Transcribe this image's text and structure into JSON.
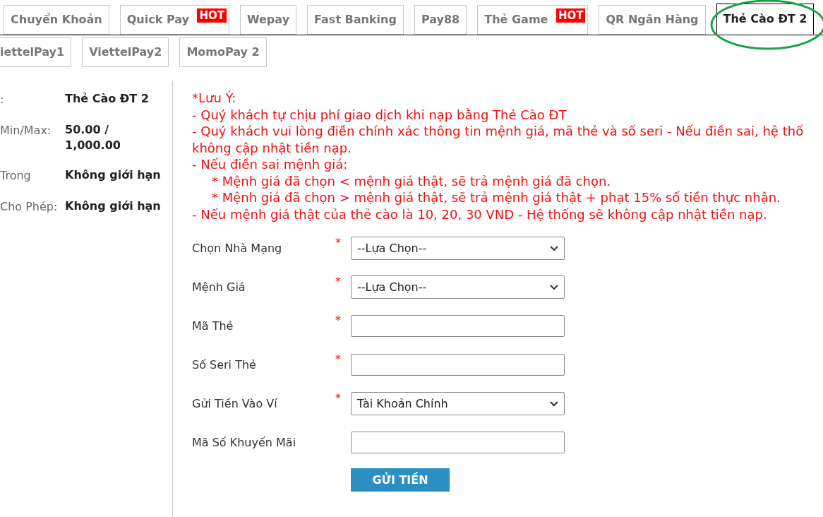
{
  "tabs_row_1": [
    {
      "label": "Chuyển Khoản",
      "selected": false,
      "hot": false
    },
    {
      "label": "Quick Pay",
      "selected": false,
      "hot": true,
      "badge": "HOT"
    },
    {
      "label": "Wepay",
      "selected": false,
      "hot": false
    },
    {
      "label": "Fast Banking",
      "selected": false,
      "hot": false
    },
    {
      "label": "Pay88",
      "selected": false,
      "hot": false
    },
    {
      "label": "Thẻ Game",
      "selected": false,
      "hot": true,
      "badge": "HOT"
    },
    {
      "label": "QR Ngân Hàng",
      "selected": false,
      "hot": false
    },
    {
      "label": "Thẻ Cào ĐT 2",
      "selected": true,
      "hot": false,
      "circled": true
    }
  ],
  "tabs_row_2": [
    {
      "label": "iettelPay1",
      "selected": false
    },
    {
      "label": "ViettelPay2",
      "selected": false
    },
    {
      "label": "MomoPay 2",
      "selected": false
    }
  ],
  "info": [
    {
      "label": ":",
      "value": "Thẻ Cào ĐT 2"
    },
    {
      "label": "Min/Max:",
      "value": "50.00 / 1,000.00"
    },
    {
      "label": "Trong",
      "value": "Không giới hạn"
    },
    {
      "label": "Cho Phép:",
      "value": "Không giới hạn"
    }
  ],
  "notes": {
    "title": "*Lưu Ý:",
    "lines": [
      {
        "text": "- Quý khách tự chịu phí giao dịch khi nạp bằng Thẻ Cào ĐT",
        "indent": false
      },
      {
        "text": "- Quý khách vui lòng điền chính xác thông tin mệnh giá, mã thẻ và số seri - Nếu điền sai, hệ thố",
        "indent": false
      },
      {
        "text": "không cập nhật tiền nạp.",
        "indent": false
      },
      {
        "text": "- Nếu điền sai mệnh giá:",
        "indent": false
      },
      {
        "text": "* Mệnh giá đã chọn < mệnh giá thật, sẽ trả mệnh giá đã chọn.",
        "indent": true
      },
      {
        "text": "* Mệnh giá đã chọn > mệnh giá thật, sẽ trả mệnh giá thật + phạt 15% số tiền thực nhận.",
        "indent": true
      },
      {
        "text": "- Nếu mệnh giá thật của thẻ cào là 10, 20, 30 VND - Hệ thống sẽ không cập nhật tiền nạp.",
        "indent": false
      }
    ]
  },
  "form": [
    {
      "label": "Chọn Nhà Mạng",
      "required_mark": "*",
      "kind": "select",
      "value": "--Lựa Chọn--"
    },
    {
      "label": "Mệnh Giá",
      "required_mark": "*",
      "kind": "select",
      "value": "--Lựa Chọn--"
    },
    {
      "label": "Mã Thẻ",
      "required_mark": "*",
      "kind": "input"
    },
    {
      "label": "Số Seri Thẻ",
      "required_mark": "*",
      "kind": "input"
    },
    {
      "label": "Gửi Tiền Vào Ví",
      "required_mark": "*",
      "kind": "select",
      "value": "Tài Khoản Chính"
    },
    {
      "label": "Mã Số Khuyến Mãi",
      "kind": "input"
    }
  ],
  "submit": "GỬI TIỀN"
}
